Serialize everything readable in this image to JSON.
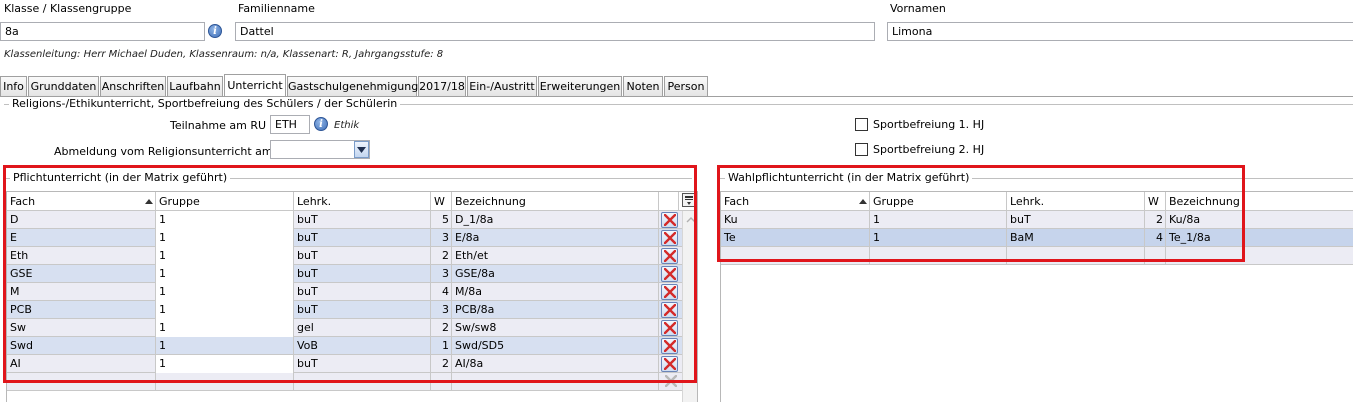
{
  "header": {
    "klasse_label": "Klasse / Klassengruppe",
    "klasse_value": "8a",
    "familienname_label": "Familienname",
    "familienname_value": "Dattel",
    "vornamen_label": "Vornamen",
    "vornamen_value": "Limona",
    "info_line": "Klassenleitung: Herr Michael Duden, Klassenraum: n/a, Klassenart: R, Jahrgangsstufe: 8"
  },
  "tabs": [
    "Info",
    "Grunddaten",
    "Anschriften",
    "Laufbahn",
    "Unterricht",
    "Gastschulgenehmigung",
    "2017/18",
    "Ein-/Austritt",
    "Erweiterungen",
    "Noten",
    "Person"
  ],
  "active_tab": "Unterricht",
  "religion": {
    "group_title": "Religions-/Ethikunterricht, Sportbefreiung des Schülers / der Schülerin",
    "teilnahme_label": "Teilnahme am RU",
    "teilnahme_value": "ETH",
    "teilnahme_info": "Ethik",
    "abmeldung_label": "Abmeldung vom Religionsunterricht am",
    "abmeldung_value": "",
    "sport1_label": "Sportbefreiung 1. HJ",
    "sport2_label": "Sportbefreiung 2. HJ"
  },
  "pflicht": {
    "title": "Pflichtunterricht (in der Matrix geführt)",
    "columns": [
      "Fach",
      "Gruppe",
      "Lehrk.",
      "W",
      "Bezeichnung"
    ],
    "rows": [
      {
        "fach": "D",
        "gruppe": "1",
        "lehrk": "buT",
        "w": "5",
        "bez": "D_1/8a"
      },
      {
        "fach": "E",
        "gruppe": "1",
        "lehrk": "buT",
        "w": "3",
        "bez": "E/8a"
      },
      {
        "fach": "Eth",
        "gruppe": "1",
        "lehrk": "buT",
        "w": "2",
        "bez": "Eth/et"
      },
      {
        "fach": "GSE",
        "gruppe": "1",
        "lehrk": "buT",
        "w": "3",
        "bez": "GSE/8a"
      },
      {
        "fach": "M",
        "gruppe": "1",
        "lehrk": "buT",
        "w": "4",
        "bez": "M/8a"
      },
      {
        "fach": "PCB",
        "gruppe": "1",
        "lehrk": "buT",
        "w": "3",
        "bez": "PCB/8a"
      },
      {
        "fach": "Sw",
        "gruppe": "1",
        "lehrk": "gel",
        "w": "2",
        "bez": "Sw/sw8"
      },
      {
        "fach": "Swd",
        "gruppe": "1",
        "lehrk": "VoB",
        "w": "1",
        "bez": "Swd/SD5"
      },
      {
        "fach": "AI",
        "gruppe": "1",
        "lehrk": "buT",
        "w": "2",
        "bez": "AI/8a"
      }
    ]
  },
  "wahl": {
    "title": "Wahlpflichtunterricht (in der Matrix geführt)",
    "columns": [
      "Fach",
      "Gruppe",
      "Lehrk.",
      "W",
      "Bezeichnung"
    ],
    "rows": [
      {
        "fach": "Ku",
        "gruppe": "1",
        "lehrk": "buT",
        "w": "2",
        "bez": "Ku/8a"
      },
      {
        "fach": "Te",
        "gruppe": "1",
        "lehrk": "BaM",
        "w": "4",
        "bez": "Te_1/8a"
      }
    ]
  },
  "colors": {
    "highlight": "#e0151b",
    "row_alt": "#dde4f2",
    "row_plain": "#ececf4",
    "selected": "#c6d4ec"
  },
  "icons": [
    "info-icon",
    "delete-x-icon",
    "dropdown-arrow-icon",
    "column-chooser-icon",
    "sort-ascending-icon"
  ]
}
